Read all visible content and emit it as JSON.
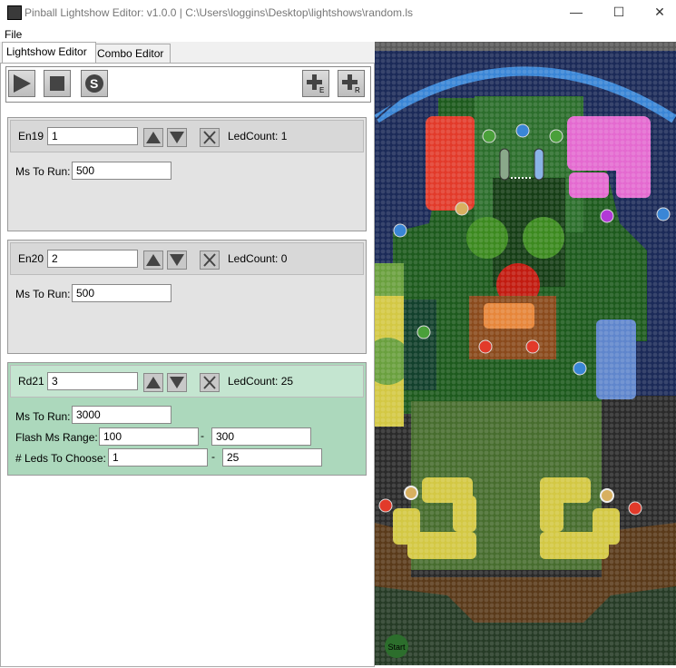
{
  "window": {
    "title": "Pinball Lightshow Editor: v1.0.0 | C:\\Users\\loggins\\Desktop\\lightshows\\random.ls",
    "minimize": "—",
    "maximize": "☐",
    "close": "✕"
  },
  "menu": {
    "file": "File"
  },
  "tabs": [
    {
      "label": "Lightshow Editor",
      "active": true
    },
    {
      "label": "Combo Editor",
      "active": false
    }
  ],
  "toolbar": {
    "play_icon": "play-icon",
    "stop_icon": "stop-icon",
    "save_label": "S",
    "add_e_label": "E",
    "add_r_label": "R"
  },
  "entries": [
    {
      "name": "En19",
      "value": "1",
      "led_count": "LedCount: 1",
      "ms_label": "Ms To Run:",
      "ms_value": "500",
      "color": "#dcdcdc"
    },
    {
      "name": "En20",
      "value": "2",
      "led_count": "LedCount: 0",
      "ms_label": "Ms To Run:",
      "ms_value": "500",
      "color": "#dcdcdc"
    },
    {
      "name": "Rd21",
      "value": "3",
      "led_count": "LedCount: 25",
      "ms_label": "Ms To Run:",
      "ms_value": "3000",
      "color": "#acd8bc",
      "flash_label": "Flash Ms Range:",
      "flash_min": "100",
      "flash_max": "300",
      "dash": "-",
      "leds_label": "# Leds To Choose:",
      "leds_min": "1",
      "leds_max": "25"
    }
  ],
  "playfield": {
    "start_label": "Start"
  }
}
